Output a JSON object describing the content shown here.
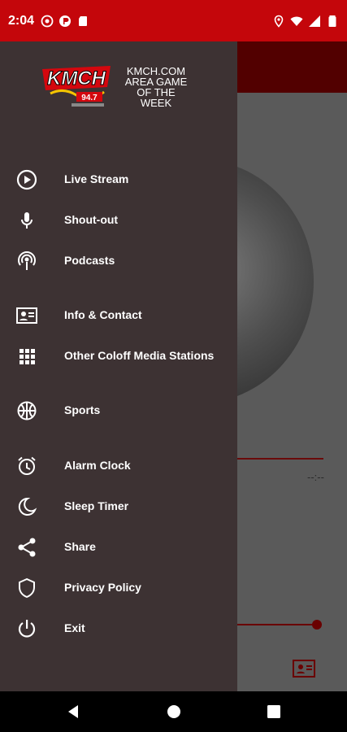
{
  "status_bar": {
    "time": "2:04",
    "left_icons": [
      "media-icon",
      "app-icon",
      "sd-card-icon"
    ],
    "right_icons": [
      "location-icon",
      "wifi-icon",
      "signal-icon",
      "battery-icon"
    ]
  },
  "background_app": {
    "duration": "--:--"
  },
  "drawer": {
    "logo_text": "KMCH",
    "logo_sub": "94.7",
    "header_text": "KMCH.COM AREA GAME OF THE WEEK",
    "items": [
      {
        "label": "Live Stream",
        "icon": "play-circle-icon"
      },
      {
        "label": "Shout-out",
        "icon": "microphone-icon"
      },
      {
        "label": "Podcasts",
        "icon": "podcast-icon"
      },
      {
        "label": "Info & Contact",
        "icon": "contact-card-icon"
      },
      {
        "label": "Other Coloff Media Stations",
        "icon": "grid-icon"
      },
      {
        "label": "Sports",
        "icon": "basketball-icon"
      },
      {
        "label": "Alarm Clock",
        "icon": "alarm-clock-icon"
      },
      {
        "label": "Sleep Timer",
        "icon": "moon-icon"
      },
      {
        "label": "Share",
        "icon": "share-icon"
      },
      {
        "label": "Privacy Policy",
        "icon": "shield-icon"
      },
      {
        "label": "Exit",
        "icon": "power-icon"
      }
    ]
  },
  "colors": {
    "status_bar": "#c4060b",
    "drawer_bg": "#3d3233",
    "accent_dark": "#520000"
  }
}
